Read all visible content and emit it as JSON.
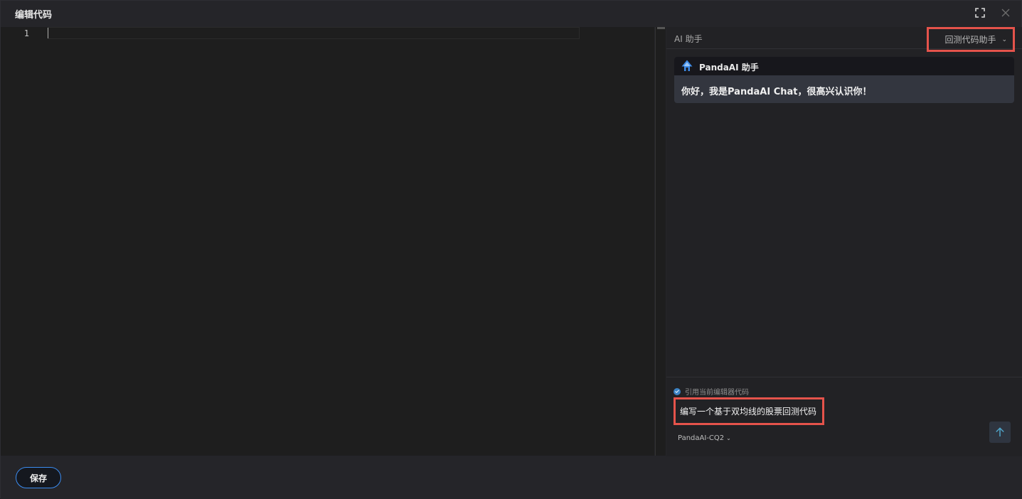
{
  "window": {
    "title": "编辑代码",
    "fullscreen_icon": "fullscreen-icon",
    "close_icon": "close-icon"
  },
  "editor": {
    "line_numbers": [
      "1"
    ],
    "code": ""
  },
  "ai_panel": {
    "title": "AI 助手",
    "mode": "回测代码助手",
    "chat": {
      "bot_name": "PandaAI 助手",
      "message": "你好，我是PandaAI Chat，很高兴认识你！"
    },
    "input": {
      "reference_label": "引用当前编辑器代码",
      "reference_checked": true,
      "prompt": "编写一个基于双均线的股票回测代码",
      "model": "PandaAI-CQ2"
    }
  },
  "footer": {
    "save_label": "保存"
  },
  "colors": {
    "accent": "#3b8cf0",
    "highlight_border": "#e5534b",
    "background": "#1e1e1e"
  }
}
